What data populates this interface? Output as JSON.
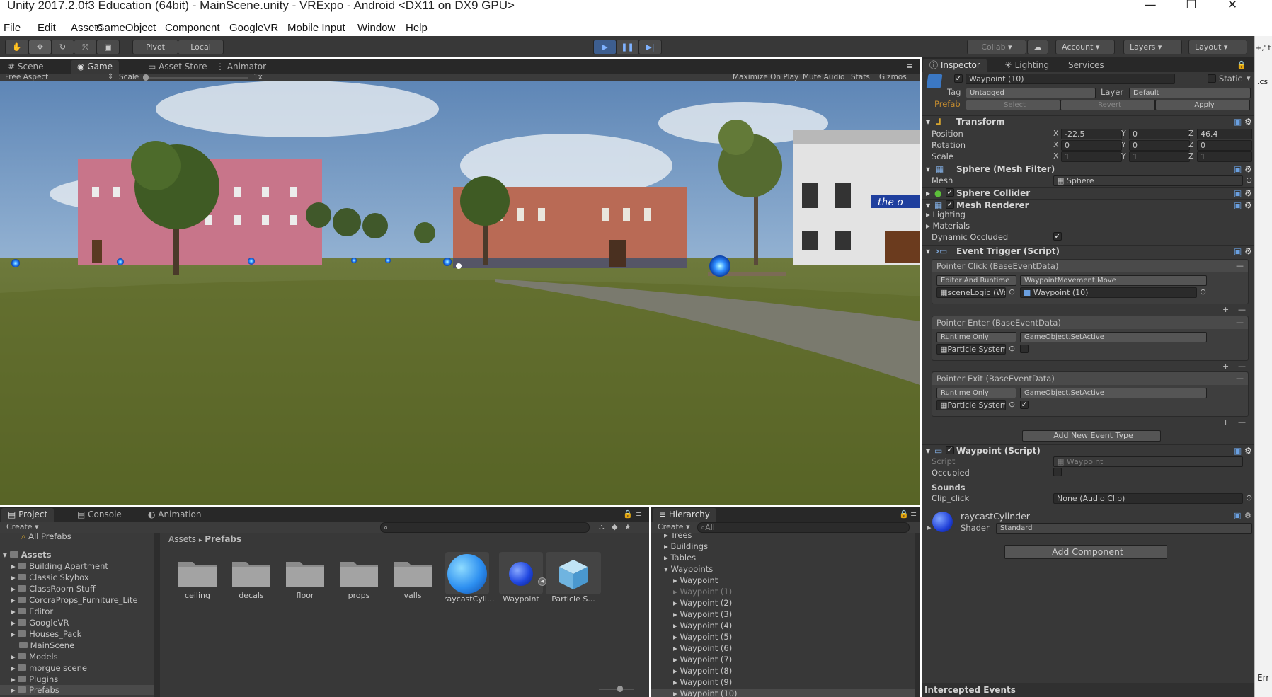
{
  "window": {
    "title": "Unity 2017.2.0f3 Education (64bit) - MainScene.unity - VRExpo - Android <DX11 on DX9 GPU>"
  },
  "menu": [
    "File",
    "Edit",
    "Assets",
    "GameObject",
    "Component",
    "GoogleVR",
    "Mobile Input",
    "Window",
    "Help"
  ],
  "toolbar": {
    "pivot": "Pivot",
    "local": "Local",
    "collab": "Collab",
    "account": "Account",
    "layers": "Layers",
    "layout": "Layout"
  },
  "scene_tabs": {
    "scene": "Scene",
    "game": "Game",
    "asset_store": "Asset Store",
    "animator": "Animator"
  },
  "game_bar": {
    "aspect": "Free Aspect",
    "scale_label": "Scale",
    "scale_value": "1x",
    "maximize": "Maximize On Play",
    "mute": "Mute Audio",
    "stats": "Stats",
    "gizmos": "Gizmos"
  },
  "scene": {
    "sign": "the o"
  },
  "inspector": {
    "tabs": [
      "Inspector",
      "Lighting",
      "Services"
    ],
    "object_name": "Waypoint (10)",
    "static": "Static",
    "tag_label": "Tag",
    "tag": "Untagged",
    "layer_label": "Layer",
    "layer": "Default",
    "prefab_label": "Prefab",
    "select": "Select",
    "revert": "Revert",
    "apply": "Apply",
    "transform": {
      "title": "Transform",
      "rows": [
        {
          "label": "Position",
          "x": "-22.5",
          "y": "0",
          "z": "46.4"
        },
        {
          "label": "Rotation",
          "x": "0",
          "y": "0",
          "z": "0"
        },
        {
          "label": "Scale",
          "x": "1",
          "y": "1",
          "z": "1"
        }
      ]
    },
    "mesh_filter": {
      "title": "Sphere (Mesh Filter)",
      "mesh_label": "Mesh",
      "mesh": "Sphere"
    },
    "sphere_collider": "Sphere Collider",
    "mesh_renderer": {
      "title": "Mesh Renderer",
      "lighting": "Lighting",
      "materials": "Materials",
      "dynamic": "Dynamic Occluded"
    },
    "event_trigger": {
      "title": "Event Trigger (Script)",
      "events": [
        {
          "name": "Pointer Click (BaseEventData)",
          "mode": "Editor And Runtime",
          "func": "WaypointMovement.Move",
          "obj": "sceneLogic (Way",
          "arg": "Waypoint (10)"
        },
        {
          "name": "Pointer Enter (BaseEventData)",
          "mode": "Runtime Only",
          "func": "GameObject.SetActive",
          "obj": "Particle System",
          "arg": ""
        },
        {
          "name": "Pointer Exit (BaseEventData)",
          "mode": "Runtime Only",
          "func": "GameObject.SetActive",
          "obj": "Particle System",
          "arg": "✓"
        }
      ],
      "add_event": "Add New Event Type"
    },
    "waypoint_script": {
      "title": "Waypoint (Script)",
      "script_label": "Script",
      "script": "Waypoint",
      "occupied": "Occupied",
      "sounds": "Sounds",
      "clip_label": "Clip_click",
      "clip": "None (Audio Clip)"
    },
    "material": {
      "name": "raycastCylinder",
      "shader_label": "Shader",
      "shader": "Standard"
    },
    "add_component": "Add Component",
    "footer": "Intercepted Events"
  },
  "project": {
    "tabs": [
      "Project",
      "Console",
      "Animation"
    ],
    "create": "Create",
    "favorite": "All Prefabs",
    "root": "Assets",
    "folders": [
      "Building Apartment",
      "Classic Skybox",
      "ClassRoom Stuff",
      "CorcraProps_Furniture_Lite",
      "Editor",
      "GoogleVR",
      "Houses_Pack",
      "MainScene",
      "Models",
      "morgue scene",
      "Plugins",
      "Prefabs"
    ],
    "breadcrumb_root": "Assets",
    "breadcrumb_sep": "▸",
    "breadcrumb_current": "Prefabs",
    "assets": [
      "ceiling",
      "decals",
      "floor",
      "props",
      "valls",
      "raycastCyli...",
      "Waypoint",
      "Particle S..."
    ]
  },
  "hierarchy": {
    "tab": "Hierarchy",
    "create": "Create",
    "search": "All",
    "items": [
      "Trees",
      "Buildings",
      "Tables",
      "Waypoints",
      "Waypoint",
      "Waypoint (1)",
      "Waypoint (2)",
      "Waypoint (3)",
      "Waypoint (4)",
      "Waypoint (5)",
      "Waypoint (6)",
      "Waypoint (7)",
      "Waypoint (8)",
      "Waypoint (9)",
      "Waypoint (10)"
    ]
  },
  "right_edge": {
    "snippet1": "+,' t",
    "snippet2": ".cs",
    "snippet3": "Err"
  }
}
